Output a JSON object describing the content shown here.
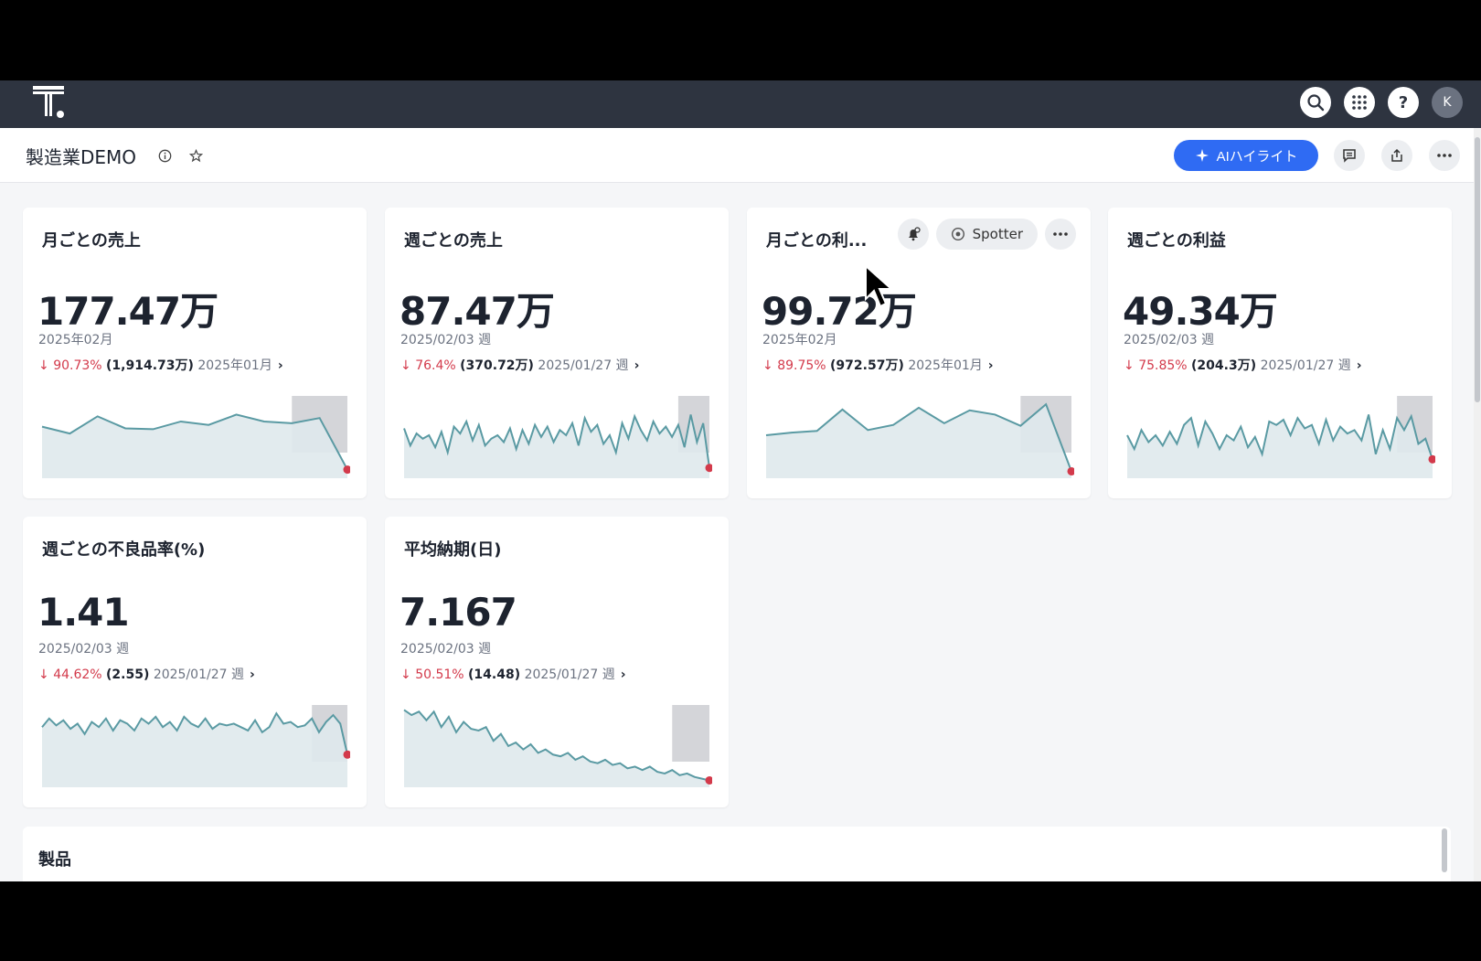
{
  "topbar": {
    "icons": [
      "search-icon",
      "apps-grid-icon",
      "help-icon"
    ],
    "help_label": "?",
    "avatar_initial": "K"
  },
  "header": {
    "title": "製造業DEMO",
    "ai_button_label": "AIハイライト"
  },
  "cards": [
    {
      "title": "月ごとの売上",
      "value": "177.47万",
      "period": "2025年02月",
      "change_pct": "90.73%",
      "change_abs": "(1,914.73万)",
      "compare_period": "2025年01月",
      "series": [
        60,
        52,
        72,
        58,
        57,
        66,
        62,
        74,
        66,
        64,
        70,
        10
      ]
    },
    {
      "title": "週ごとの売上",
      "value": "87.47万",
      "period": "2025/02/03 週",
      "change_pct": "76.4%",
      "change_abs": "(370.72万)",
      "compare_period": "2025/01/27 週",
      "series": [
        58,
        38,
        52,
        46,
        50,
        36,
        54,
        30,
        60,
        52,
        66,
        44,
        62,
        38,
        46,
        50,
        42,
        58,
        34,
        56,
        40,
        62,
        48,
        60,
        42,
        56,
        50,
        64,
        38,
        70,
        54,
        62,
        40,
        50,
        30,
        64,
        46,
        72,
        56,
        44,
        66,
        52,
        60,
        48,
        62,
        36,
        74,
        42,
        64,
        12
      ]
    },
    {
      "title": "月ごとの利...",
      "value": "99.72万",
      "period": "2025年02月",
      "change_pct": "89.75%",
      "change_abs": "(972.57万)",
      "compare_period": "2025年01月",
      "spotter_label": "Spotter",
      "series": [
        50,
        53,
        55,
        80,
        56,
        62,
        82,
        64,
        79,
        74,
        61,
        86,
        8
      ]
    },
    {
      "title": "週ごとの利益",
      "value": "49.34万",
      "period": "2025/02/03 週",
      "change_pct": "75.85%",
      "change_abs": "(204.3万)",
      "compare_period": "2025/01/27 週",
      "series": [
        50,
        34,
        56,
        42,
        50,
        38,
        54,
        40,
        62,
        70,
        38,
        66,
        52,
        34,
        50,
        44,
        60,
        36,
        48,
        28,
        66,
        62,
        68,
        50,
        70,
        58,
        62,
        40,
        68,
        44,
        60,
        52,
        56,
        44,
        74,
        28,
        56,
        34,
        70,
        56,
        72,
        40,
        46,
        22
      ]
    },
    {
      "title": "週ごとの不良品率(%)",
      "value": "1.41",
      "period": "2025/02/03 週",
      "change_pct": "44.62%",
      "change_abs": "(2.55)",
      "compare_period": "2025/01/27 週",
      "series": [
        70,
        80,
        72,
        78,
        68,
        74,
        62,
        76,
        70,
        80,
        66,
        78,
        74,
        66,
        80,
        74,
        82,
        70,
        76,
        66,
        82,
        74,
        70,
        80,
        68,
        74,
        72,
        74,
        70,
        66,
        78,
        64,
        70,
        86,
        74,
        76,
        70,
        72,
        80,
        64,
        76,
        84,
        74,
        38
      ]
    },
    {
      "title": "平均納期(日)",
      "value": "7.167",
      "period": "2025/02/03 週",
      "change_pct": "50.51%",
      "change_abs": "(14.48)",
      "compare_period": "2025/01/27 週",
      "series": [
        90,
        84,
        88,
        78,
        88,
        70,
        82,
        64,
        76,
        68,
        66,
        70,
        54,
        62,
        48,
        52,
        44,
        50,
        40,
        44,
        38,
        36,
        40,
        32,
        36,
        30,
        28,
        32,
        26,
        28,
        22,
        24,
        20,
        24,
        18,
        16,
        20,
        14,
        16,
        12,
        10,
        8
      ]
    }
  ],
  "section": {
    "title": "製品"
  },
  "colors": {
    "topbar": "#2e3440",
    "accent": "#2f6bf3",
    "negative": "#d33a4b",
    "line": "#5a9aa3",
    "area": "#dfe9ec"
  }
}
